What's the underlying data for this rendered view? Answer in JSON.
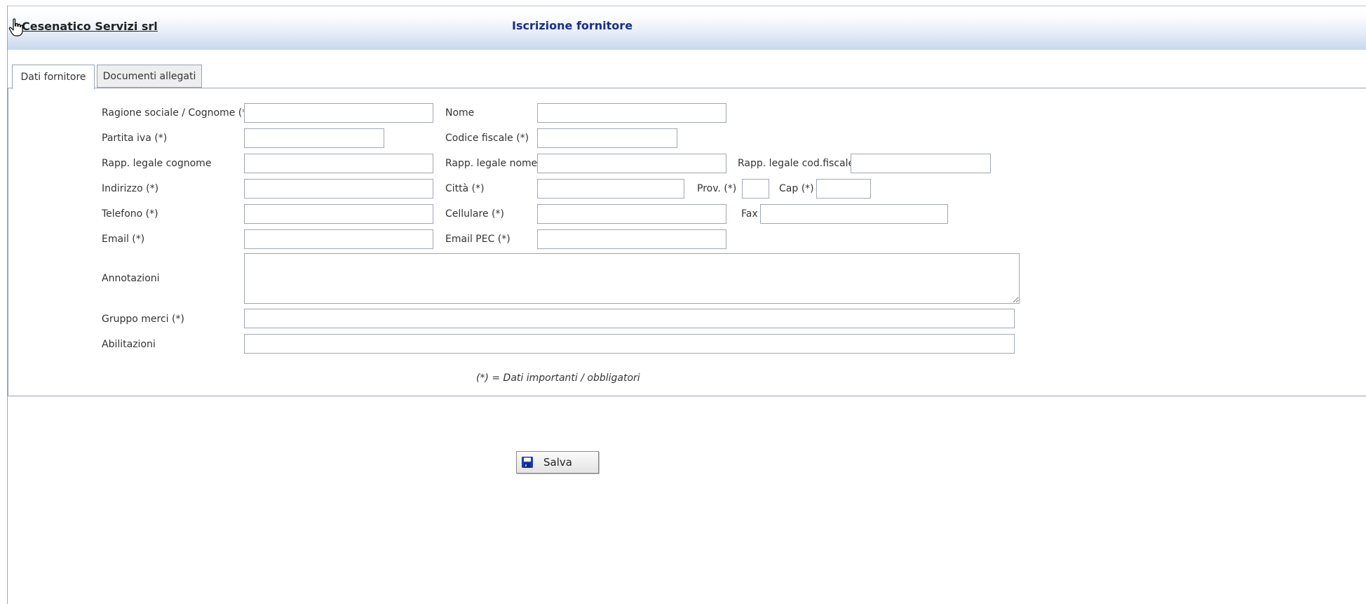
{
  "header": {
    "company": "Cesenatico Servizi srl",
    "title": "Iscrizione fornitore"
  },
  "tabs": [
    {
      "label": "Dati fornitore",
      "active": true
    },
    {
      "label": "Documenti allegati",
      "active": false
    }
  ],
  "form": {
    "ragione_sociale": {
      "label": "Ragione sociale / Cognome (*)",
      "value": ""
    },
    "nome": {
      "label": "Nome",
      "value": ""
    },
    "partita_iva": {
      "label": "Partita iva (*)",
      "value": ""
    },
    "codice_fiscale": {
      "label": "Codice fiscale (*)",
      "value": ""
    },
    "rapp_cognome": {
      "label": "Rapp. legale cognome",
      "value": ""
    },
    "rapp_nome": {
      "label": "Rapp. legale nome",
      "value": ""
    },
    "rapp_cf": {
      "label": "Rapp. legale cod.fiscale",
      "value": ""
    },
    "indirizzo": {
      "label": "Indirizzo (*)",
      "value": ""
    },
    "citta": {
      "label": "Città (*)",
      "value": ""
    },
    "prov": {
      "label": "Prov. (*)",
      "value": ""
    },
    "cap": {
      "label": "Cap (*)",
      "value": ""
    },
    "telefono": {
      "label": "Telefono (*)",
      "value": ""
    },
    "cellulare": {
      "label": "Cellulare (*)",
      "value": ""
    },
    "fax": {
      "label": "Fax",
      "value": ""
    },
    "email": {
      "label": "Email (*)",
      "value": ""
    },
    "email_pec": {
      "label": "Email PEC (*)",
      "value": ""
    },
    "annotazioni": {
      "label": "Annotazioni",
      "value": ""
    },
    "gruppo_merci": {
      "label": "Gruppo merci (*)",
      "value": ""
    },
    "abilitazioni": {
      "label": "Abilitazioni",
      "value": ""
    }
  },
  "legend": "(*) = Dati importanti / obbligatori",
  "actions": {
    "save_label": "Salva"
  },
  "colors": {
    "title": "#1a2e8a",
    "save_icon": "#1b3fa8"
  },
  "icons": {
    "cursor": "hand-pointer-icon",
    "save": "floppy-disk-icon"
  }
}
